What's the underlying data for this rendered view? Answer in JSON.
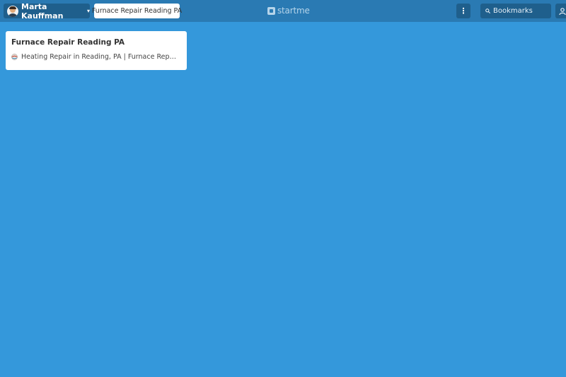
{
  "header": {
    "user_name": "Marta Kauffman",
    "page_tab": "Furnace Repair Reading PA",
    "logo_text": "startme",
    "more_label": "⋮",
    "search_placeholder": "Bookmarks"
  },
  "widgets": [
    {
      "title": "Furnace Repair Reading PA",
      "bookmarks": [
        {
          "label": "Heating Repair in Reading, PA | Furnace Repair S...",
          "icon": "globe-favicon"
        }
      ]
    }
  ],
  "colors": {
    "background": "#3498db",
    "topbar": "#2a7ab3",
    "button": "#1f5f8c"
  }
}
